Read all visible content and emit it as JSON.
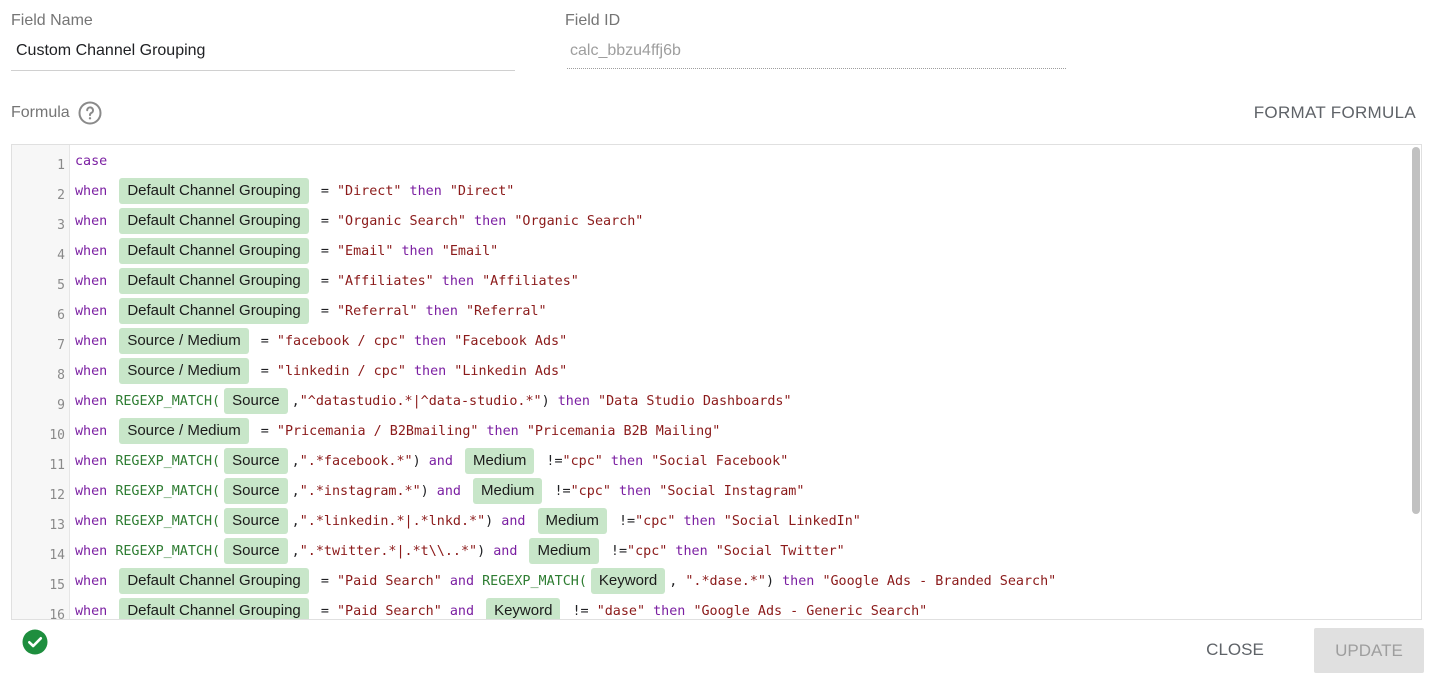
{
  "field_name": {
    "label": "Field Name",
    "value": "Custom Channel Grouping"
  },
  "field_id": {
    "label": "Field ID",
    "value": "calc_bbzu4ffj6b"
  },
  "formula": {
    "label": "Formula",
    "help_icon": "question-circle-icon",
    "format_label": "FORMAT FORMULA"
  },
  "editor": {
    "lines": [
      {
        "num": "1",
        "tokens": [
          [
            "kw",
            "case"
          ]
        ]
      },
      {
        "num": "2",
        "tokens": [
          [
            "kw",
            "when "
          ],
          [
            "chip",
            "Default Channel Grouping"
          ],
          [
            "op",
            " = "
          ],
          [
            "str",
            "\"Direct\""
          ],
          [
            "op",
            " "
          ],
          [
            "kw",
            "then"
          ],
          [
            "op",
            " "
          ],
          [
            "str",
            "\"Direct\""
          ]
        ]
      },
      {
        "num": "3",
        "tokens": [
          [
            "kw",
            "when "
          ],
          [
            "chip",
            "Default Channel Grouping"
          ],
          [
            "op",
            " = "
          ],
          [
            "str",
            "\"Organic Search\""
          ],
          [
            "op",
            " "
          ],
          [
            "kw",
            "then"
          ],
          [
            "op",
            " "
          ],
          [
            "str",
            "\"Organic Search\""
          ]
        ]
      },
      {
        "num": "4",
        "tokens": [
          [
            "kw",
            "when "
          ],
          [
            "chip",
            "Default Channel Grouping"
          ],
          [
            "op",
            " = "
          ],
          [
            "str",
            "\"Email\""
          ],
          [
            "op",
            " "
          ],
          [
            "kw",
            "then"
          ],
          [
            "op",
            " "
          ],
          [
            "str",
            "\"Email\""
          ]
        ]
      },
      {
        "num": "5",
        "tokens": [
          [
            "kw",
            "when "
          ],
          [
            "chip",
            "Default Channel Grouping"
          ],
          [
            "op",
            " = "
          ],
          [
            "str",
            "\"Affiliates\""
          ],
          [
            "op",
            " "
          ],
          [
            "kw",
            "then"
          ],
          [
            "op",
            " "
          ],
          [
            "str",
            "\"Affiliates\""
          ]
        ]
      },
      {
        "num": "6",
        "tokens": [
          [
            "kw",
            "when "
          ],
          [
            "chip",
            "Default Channel Grouping"
          ],
          [
            "op",
            " = "
          ],
          [
            "str",
            "\"Referral\""
          ],
          [
            "op",
            " "
          ],
          [
            "kw",
            "then"
          ],
          [
            "op",
            " "
          ],
          [
            "str",
            "\"Referral\""
          ]
        ]
      },
      {
        "num": "7",
        "tokens": [
          [
            "kw",
            "when "
          ],
          [
            "chip",
            "Source / Medium"
          ],
          [
            "op",
            " = "
          ],
          [
            "str",
            "\"facebook / cpc\""
          ],
          [
            "op",
            " "
          ],
          [
            "kw",
            "then"
          ],
          [
            "op",
            " "
          ],
          [
            "str",
            "\"Facebook Ads\""
          ]
        ]
      },
      {
        "num": "8",
        "tokens": [
          [
            "kw",
            "when "
          ],
          [
            "chip",
            "Source / Medium"
          ],
          [
            "op",
            " = "
          ],
          [
            "str",
            "\"linkedin / cpc\""
          ],
          [
            "op",
            " "
          ],
          [
            "kw",
            "then"
          ],
          [
            "op",
            " "
          ],
          [
            "str",
            "\"Linkedin Ads\""
          ]
        ]
      },
      {
        "num": "9",
        "tokens": [
          [
            "kw",
            "when "
          ],
          [
            "fn",
            "REGEXP_MATCH("
          ],
          [
            "chip",
            "Source"
          ],
          [
            "op",
            ","
          ],
          [
            "str",
            "\"^datastudio.*|^data-studio.*\""
          ],
          [
            "op",
            ") "
          ],
          [
            "kw",
            "then"
          ],
          [
            "op",
            " "
          ],
          [
            "str",
            "\"Data Studio Dashboards\""
          ]
        ]
      },
      {
        "num": "10",
        "tokens": [
          [
            "kw",
            "when "
          ],
          [
            "chip",
            "Source / Medium"
          ],
          [
            "op",
            " = "
          ],
          [
            "str",
            "\"Pricemania / B2Bmailing\""
          ],
          [
            "op",
            " "
          ],
          [
            "kw",
            "then"
          ],
          [
            "op",
            " "
          ],
          [
            "str",
            "\"Pricemania B2B Mailing\""
          ]
        ]
      },
      {
        "num": "11",
        "tokens": [
          [
            "kw",
            "when "
          ],
          [
            "fn",
            "REGEXP_MATCH("
          ],
          [
            "chip",
            "Source"
          ],
          [
            "op",
            ","
          ],
          [
            "str",
            "\".*facebook.*\""
          ],
          [
            "op",
            ") "
          ],
          [
            "kw",
            "and"
          ],
          [
            "op",
            " "
          ],
          [
            "chip",
            "Medium"
          ],
          [
            "op",
            " !="
          ],
          [
            "str",
            "\"cpc\""
          ],
          [
            "op",
            " "
          ],
          [
            "kw",
            "then"
          ],
          [
            "op",
            " "
          ],
          [
            "str",
            "\"Social Facebook\""
          ]
        ]
      },
      {
        "num": "12",
        "tokens": [
          [
            "kw",
            "when "
          ],
          [
            "fn",
            "REGEXP_MATCH("
          ],
          [
            "chip",
            "Source"
          ],
          [
            "op",
            ","
          ],
          [
            "str",
            "\".*instagram.*\""
          ],
          [
            "op",
            ") "
          ],
          [
            "kw",
            "and"
          ],
          [
            "op",
            " "
          ],
          [
            "chip",
            "Medium"
          ],
          [
            "op",
            " !="
          ],
          [
            "str",
            "\"cpc\""
          ],
          [
            "op",
            " "
          ],
          [
            "kw",
            "then"
          ],
          [
            "op",
            " "
          ],
          [
            "str",
            "\"Social Instagram\""
          ]
        ]
      },
      {
        "num": "13",
        "tokens": [
          [
            "kw",
            "when "
          ],
          [
            "fn",
            "REGEXP_MATCH("
          ],
          [
            "chip",
            "Source"
          ],
          [
            "op",
            ","
          ],
          [
            "str",
            "\".*linkedin.*|.*lnkd.*\""
          ],
          [
            "op",
            ") "
          ],
          [
            "kw",
            "and"
          ],
          [
            "op",
            " "
          ],
          [
            "chip",
            "Medium"
          ],
          [
            "op",
            " !="
          ],
          [
            "str",
            "\"cpc\""
          ],
          [
            "op",
            " "
          ],
          [
            "kw",
            "then"
          ],
          [
            "op",
            " "
          ],
          [
            "str",
            "\"Social LinkedIn\""
          ]
        ]
      },
      {
        "num": "14",
        "tokens": [
          [
            "kw",
            "when "
          ],
          [
            "fn",
            "REGEXP_MATCH("
          ],
          [
            "chip",
            "Source"
          ],
          [
            "op",
            ","
          ],
          [
            "str",
            "\".*twitter.*|.*t\\\\..*\""
          ],
          [
            "op",
            ") "
          ],
          [
            "kw",
            "and"
          ],
          [
            "op",
            " "
          ],
          [
            "chip",
            "Medium"
          ],
          [
            "op",
            " !="
          ],
          [
            "str",
            "\"cpc\""
          ],
          [
            "op",
            " "
          ],
          [
            "kw",
            "then"
          ],
          [
            "op",
            " "
          ],
          [
            "str",
            "\"Social Twitter\""
          ]
        ]
      },
      {
        "num": "15",
        "tokens": [
          [
            "kw",
            "when "
          ],
          [
            "chip",
            "Default Channel Grouping"
          ],
          [
            "op",
            " = "
          ],
          [
            "str",
            "\"Paid Search\""
          ],
          [
            "op",
            " "
          ],
          [
            "kw",
            "and"
          ],
          [
            "op",
            " "
          ],
          [
            "fn",
            "REGEXP_MATCH("
          ],
          [
            "chip",
            "Keyword"
          ],
          [
            "op",
            ", "
          ],
          [
            "str",
            "\".*dase.*\""
          ],
          [
            "op",
            ") "
          ],
          [
            "kw",
            "then"
          ],
          [
            "op",
            " "
          ],
          [
            "str",
            "\"Google Ads - Branded Search\""
          ]
        ]
      },
      {
        "num": "16",
        "tokens": [
          [
            "kw",
            "when "
          ],
          [
            "chip",
            "Default Channel Grouping"
          ],
          [
            "op",
            " = "
          ],
          [
            "str",
            "\"Paid Search\""
          ],
          [
            "op",
            " "
          ],
          [
            "kw",
            "and"
          ],
          [
            "op",
            " "
          ],
          [
            "chip",
            "Keyword"
          ],
          [
            "op",
            " != "
          ],
          [
            "str",
            "\"dase\""
          ],
          [
            "op",
            " "
          ],
          [
            "kw",
            "then"
          ],
          [
            "op",
            " "
          ],
          [
            "str",
            "\"Google Ads - Generic Search\""
          ]
        ]
      }
    ]
  },
  "status": {
    "icon": "check-circle-icon",
    "color": "#1e8e3e"
  },
  "buttons": {
    "close_label": "CLOSE",
    "update_label": "UPDATE"
  }
}
